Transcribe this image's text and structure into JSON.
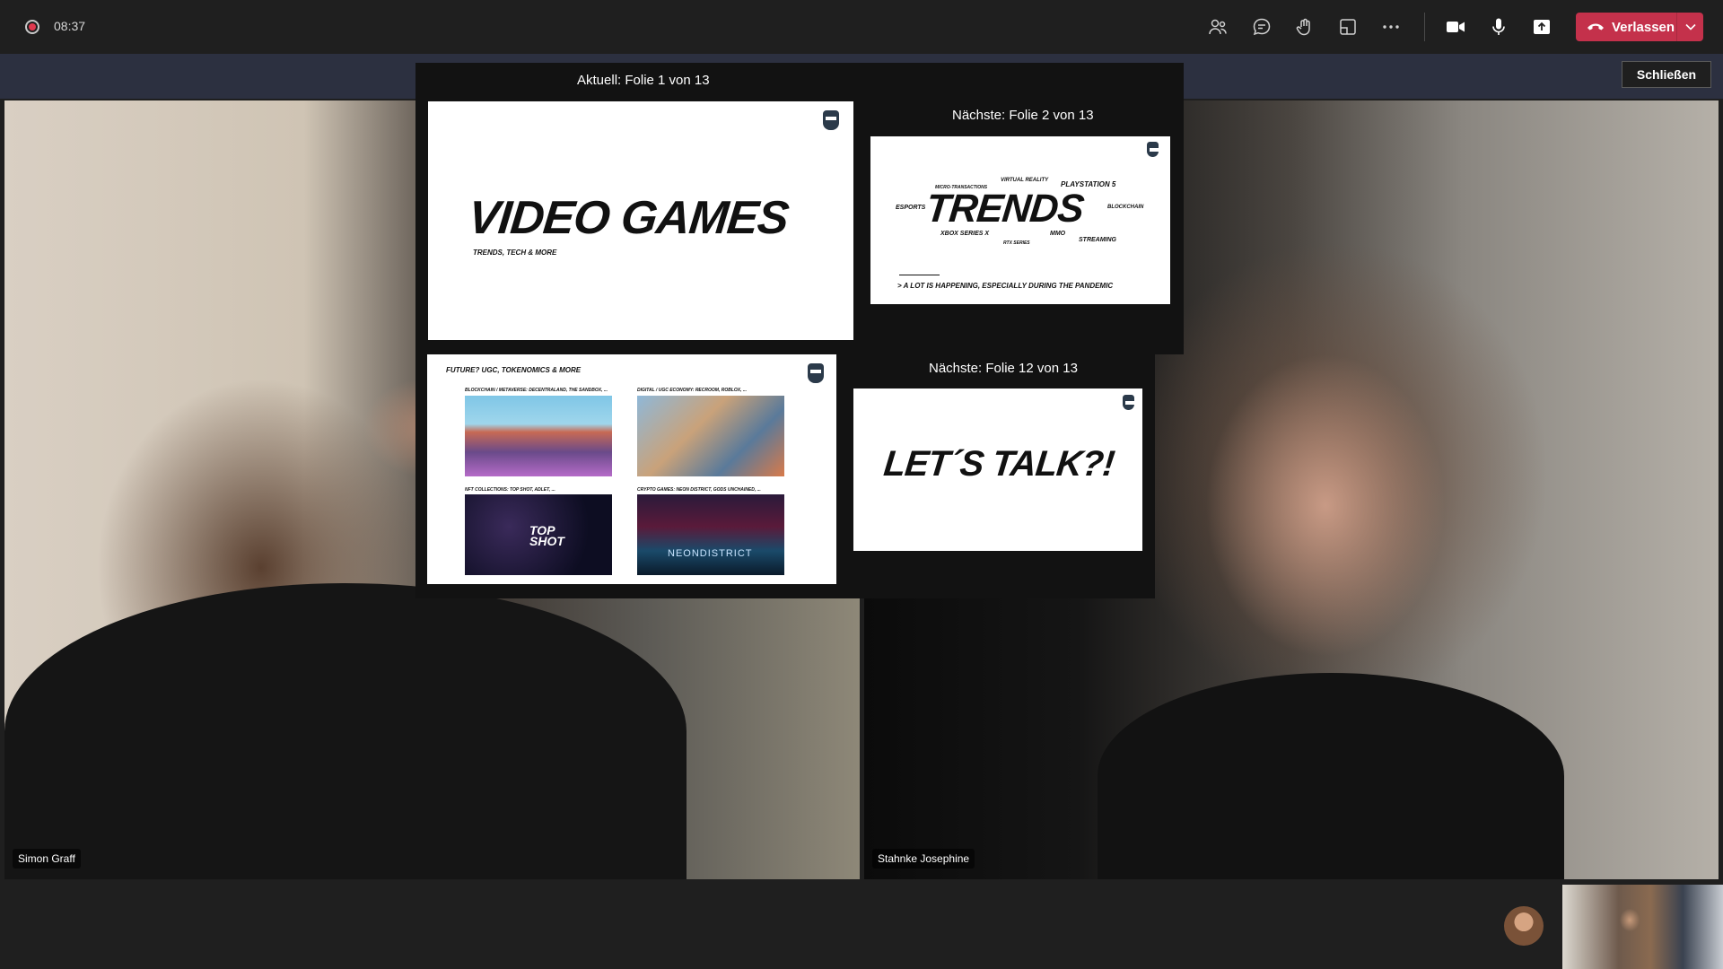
{
  "topbar": {
    "timer": "08:37",
    "leave_label": "Verlassen",
    "icons": [
      "participants-icon",
      "chat-icon",
      "reactions-icon",
      "rooms-icon",
      "more-icon",
      "camera-icon",
      "microphone-icon",
      "share-icon"
    ]
  },
  "banner": {
    "close_label": "Schließen"
  },
  "presenter": {
    "current_label": "Aktuell: Folie 1 von 13",
    "next_label": "Nächste: Folie 2 von 13",
    "upcoming_label": "Nächste: Folie 12 von 13",
    "slide1": {
      "title": "VIDEO GAMES",
      "subtitle": "TRENDS, TECH & MORE"
    },
    "slide2": {
      "title": "TRENDS",
      "words": [
        "MICRO-TRANSACTIONS",
        "VIRTUAL REALITY",
        "PLAYSTATION 5",
        "ESPORTS",
        "BLOCKCHAIN",
        "XBOX SERIES X",
        "MMO",
        "RTX SERIES",
        "STREAMING"
      ],
      "footer": "> A LOT IS HAPPENING, ESPECIALLY DURING THE PANDEMIC"
    },
    "slide11": {
      "title": "FUTURE? UGC, TOKENOMICS & MORE",
      "captions": [
        "BLOCKCHAIN / METAVERSE: DECENTRALAND, THE SANDBOX, ...",
        "DIGITAL / UGC ECONOMY: RECROOM, ROBLOX, ...",
        "NFT COLLECTIONS: TOP SHOT, ADLET, ...",
        "CRYPTO GAMES: NEON DISTRICT, GODS UNCHAINED, ..."
      ],
      "topshot": "TOP SHOT",
      "neon": "NEONDISTRICT"
    },
    "slide12": {
      "title": "LET´S TALK?!"
    }
  },
  "participants": [
    {
      "name": "Simon Graff"
    },
    {
      "name": "Stahnke Josephine"
    }
  ],
  "colors": {
    "leave": "#c4314b",
    "banner": "#2c3040",
    "background": "#1f1f1f"
  }
}
